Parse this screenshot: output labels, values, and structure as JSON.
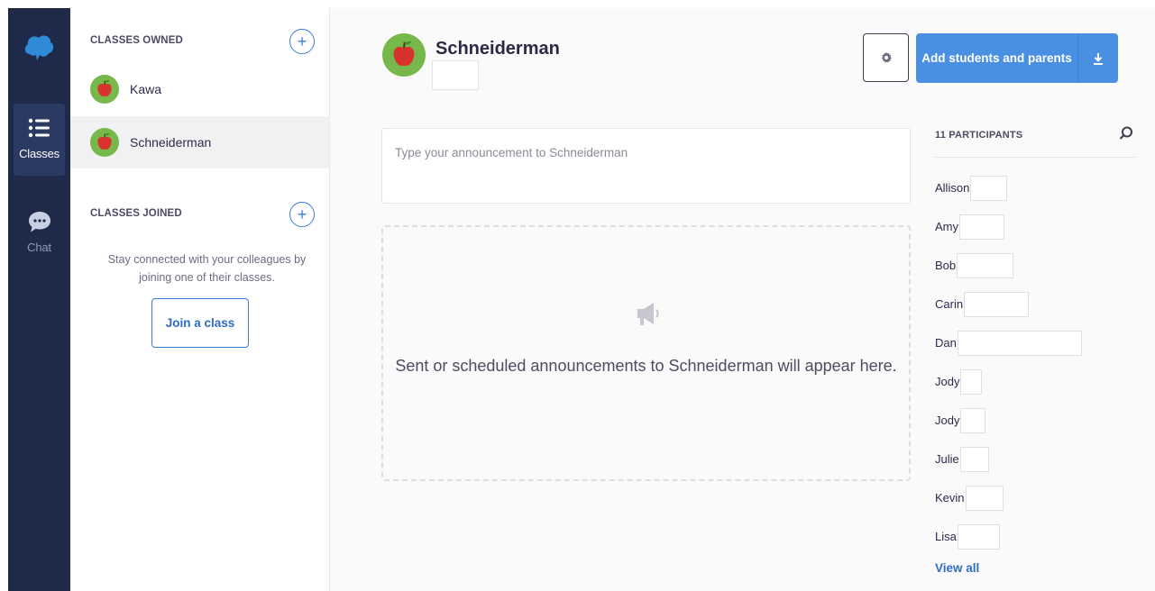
{
  "nav": {
    "items": [
      {
        "label": "Classes",
        "icon": "list-icon",
        "active": true
      },
      {
        "label": "Chat",
        "icon": "chat-bubble-icon",
        "active": false
      }
    ]
  },
  "sidebar": {
    "owned_heading": "CLASSES OWNED",
    "owned_classes": [
      {
        "name": "Kawa",
        "selected": false
      },
      {
        "name": "Schneiderman",
        "selected": true
      }
    ],
    "joined_heading": "CLASSES JOINED",
    "joined_message": "Stay connected with your colleagues by joining one of their classes.",
    "join_button": "Join a class"
  },
  "header": {
    "title": "Schneiderman",
    "add_button": "Add students and parents"
  },
  "composer": {
    "placeholder": "Type your announcement to Schneiderman"
  },
  "empty_state": {
    "message": "Sent or scheduled announcements to Schneiderman will appear here."
  },
  "participants": {
    "heading": "11 PARTICIPANTS",
    "list": [
      "Allison",
      "Amy",
      "Bob",
      "Carin",
      "Dan",
      "Jody",
      "Jody",
      "Julie",
      "Kevin",
      "Lisa"
    ],
    "view_all": "View all"
  },
  "colors": {
    "rail": "#1f2a4a",
    "accent": "#4a90e2",
    "apple_red": "#d9322c",
    "avatar_green": "#77b84a"
  }
}
